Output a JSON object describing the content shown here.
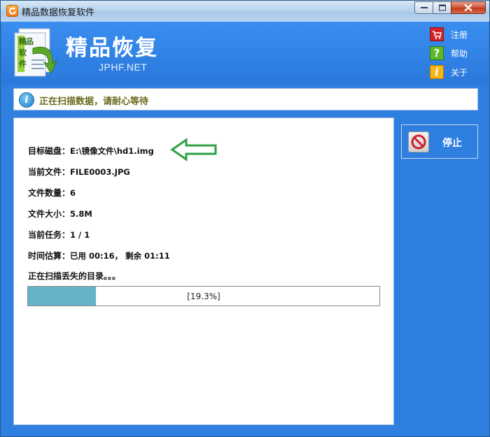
{
  "window": {
    "title": "精品数据恢复软件"
  },
  "header": {
    "brand_title": "精品恢复",
    "brand_sub": "JPHF.NET",
    "logo_text": "精品软件",
    "menu": [
      {
        "label": "注册",
        "icon": "register-cart-icon",
        "color": "#d2232a"
      },
      {
        "label": "帮助",
        "icon": "help-question-icon",
        "color": "#5cb82a"
      },
      {
        "label": "关于",
        "icon": "about-info-icon",
        "color": "#f4b61a"
      }
    ]
  },
  "status": {
    "text": "正在扫描数据，请耐心等待"
  },
  "scan": {
    "rows": [
      {
        "key": "目标磁盘：",
        "value": "E:\\镜像文件\\hd1.img"
      },
      {
        "key": "当前文件：",
        "value": "FILE0003.JPG"
      },
      {
        "key": "文件数量：",
        "value": "6"
      },
      {
        "key": "文件大小：",
        "value": "5.8M"
      },
      {
        "key": "当前任务：",
        "value": "1 / 1"
      },
      {
        "key": "时间估算：",
        "value": "已用 00:16， 剩余 01:11"
      }
    ],
    "scan_text": "正在扫描丢失的目录。。。",
    "progress": {
      "fraction": 0.193,
      "label": "[19.3%]"
    }
  },
  "actions": {
    "stop_label": "停止"
  },
  "colors": {
    "window_blue": "#2e7fe0",
    "progress_fill": "#66b2c8",
    "arrow_green": "#2ea043",
    "status_text": "#6b6a1c"
  }
}
